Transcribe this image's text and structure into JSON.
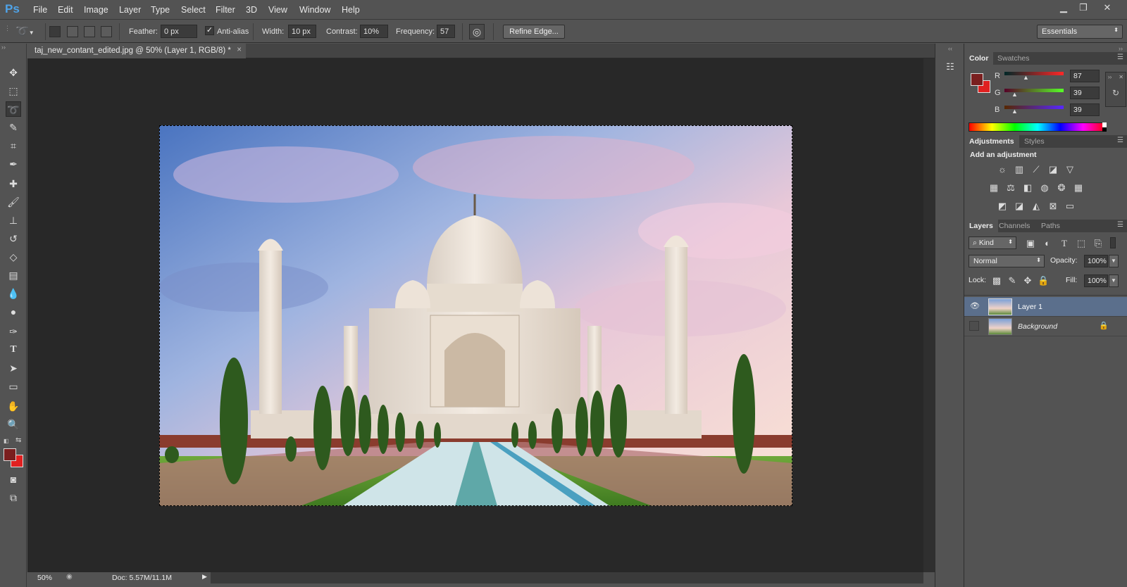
{
  "app": {
    "logo": "Ps"
  },
  "menu": [
    "File",
    "Edit",
    "Image",
    "Layer",
    "Type",
    "Select",
    "Filter",
    "3D",
    "View",
    "Window",
    "Help"
  ],
  "window_controls": [
    "minimize-icon",
    "restore-icon",
    "close-icon"
  ],
  "options": {
    "feather_label": "Feather:",
    "feather_value": "0 px",
    "antialias_label": "Anti-alias",
    "antialias_checked": true,
    "width_label": "Width:",
    "width_value": "10 px",
    "contrast_label": "Contrast:",
    "contrast_value": "10%",
    "frequency_label": "Frequency:",
    "frequency_value": "57",
    "refine_edge": "Refine Edge...",
    "workspace": "Essentials"
  },
  "document": {
    "tab_title": "taj_new_contant_edited.jpg @ 50% (Layer 1, RGB/8) *",
    "close": "×"
  },
  "status": {
    "zoom": "50%",
    "doc_size": "Doc: 5.57M/11.1M"
  },
  "tools": [
    "move-tool-icon",
    "marquee-tool-icon",
    "magnetic-lasso-tool-icon",
    "quick-selection-tool-icon",
    "crop-tool-icon",
    "eyedropper-tool-icon",
    "healing-brush-tool-icon",
    "brush-tool-icon",
    "clone-stamp-tool-icon",
    "history-brush-tool-icon",
    "eraser-tool-icon",
    "gradient-tool-icon",
    "blur-tool-icon",
    "dodge-tool-icon",
    "pen-tool-icon",
    "type-tool-icon",
    "path-selection-tool-icon",
    "rectangle-tool-icon",
    "hand-tool-icon",
    "zoom-tool-icon"
  ],
  "colors": {
    "foreground": "#7a1f1f",
    "background": "#e02020",
    "accent_ps": "#4fa3e8"
  },
  "color_panel": {
    "tabs": [
      "Color",
      "Swatches"
    ],
    "r_label": "R",
    "r_value": "87",
    "g_label": "G",
    "g_value": "39",
    "b_label": "B",
    "b_value": "39"
  },
  "adjustments_panel": {
    "tabs": [
      "Adjustments",
      "Styles"
    ],
    "heading": "Add an adjustment"
  },
  "layers_panel": {
    "tabs": [
      "Layers",
      "Channels",
      "Paths"
    ],
    "filter_kind": "Kind",
    "blend_mode": "Normal",
    "opacity_label": "Opacity:",
    "opacity_value": "100%",
    "lock_label": "Lock:",
    "fill_label": "Fill:",
    "fill_value": "100%",
    "layers": [
      {
        "name": "Layer 1",
        "selected": true,
        "visible": true
      },
      {
        "name": "Background",
        "selected": false,
        "visible": false,
        "locked": true
      }
    ]
  }
}
